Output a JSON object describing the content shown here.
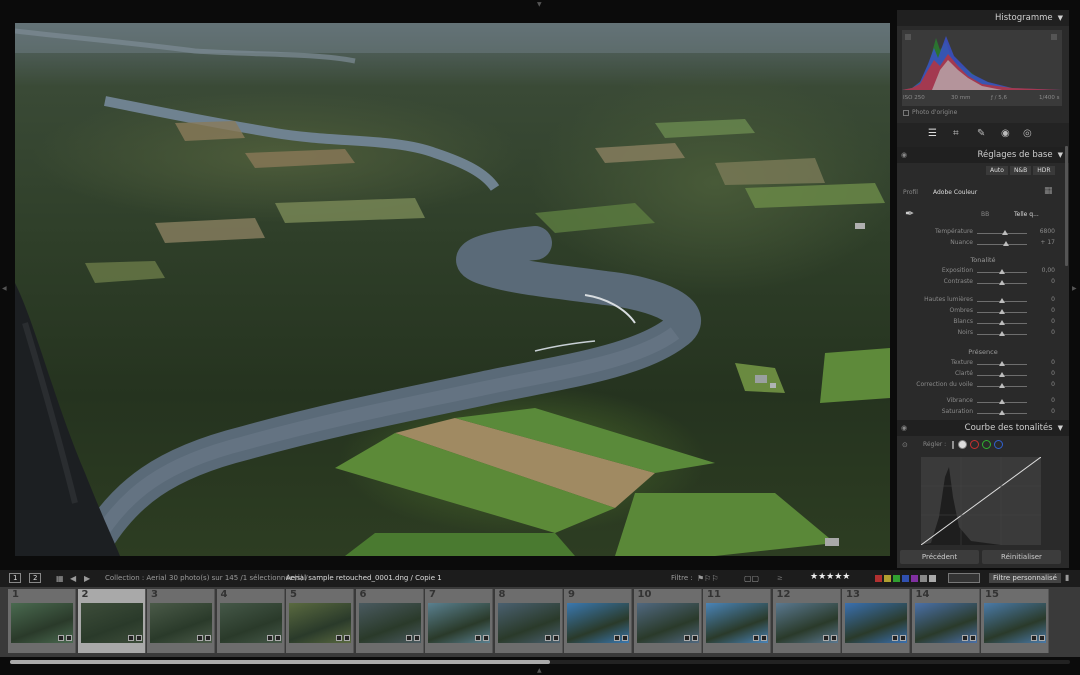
{
  "right_panel": {
    "histogram": {
      "title": "Histogramme",
      "iso": "ISO 250",
      "focal": "30 mm",
      "aperture": "ƒ / 5,6",
      "shutter": "1/400 s",
      "original_photo": "Photo d'origine"
    },
    "basic": {
      "title": "Réglages de base",
      "buttons": [
        "Auto",
        "N&B",
        "HDR"
      ],
      "profile_label": "Profil",
      "profile_value": "Adobe Couleur",
      "wb_label": "BB",
      "wb_value": "Telle q...",
      "sliders_wb": [
        {
          "label": "Température",
          "value": "6800",
          "pos": 0.55
        },
        {
          "label": "Nuance",
          "value": "+ 17",
          "pos": 0.58
        }
      ],
      "tone_title": "Tonalité",
      "sliders_tone": [
        {
          "label": "Exposition",
          "value": "0,00",
          "pos": 0.5
        },
        {
          "label": "Contraste",
          "value": "0",
          "pos": 0.5
        },
        {
          "label": "Hautes lumières",
          "value": "0",
          "pos": 0.5
        },
        {
          "label": "Ombres",
          "value": "0",
          "pos": 0.5
        },
        {
          "label": "Blancs",
          "value": "0",
          "pos": 0.5
        },
        {
          "label": "Noirs",
          "value": "0",
          "pos": 0.5
        }
      ],
      "presence_title": "Présence",
      "sliders_presence": [
        {
          "label": "Texture",
          "value": "0",
          "pos": 0.5
        },
        {
          "label": "Clarté",
          "value": "0",
          "pos": 0.5
        },
        {
          "label": "Correction du voile",
          "value": "0",
          "pos": 0.5
        },
        {
          "label": "Vibrance",
          "value": "0",
          "pos": 0.5
        },
        {
          "label": "Saturation",
          "value": "0",
          "pos": 0.5
        }
      ]
    },
    "curve": {
      "title": "Courbe des tonalités",
      "adjust_label": "Régler :"
    },
    "bottom": {
      "previous": "Précédent",
      "reset": "Réinitialiser"
    }
  },
  "toolbar": {
    "view1": "1",
    "view2": "2",
    "collection": "Collection : Aerial",
    "count": "30 photo(s) sur 145 /1 sélectionnée(s) /",
    "filename": "Aerial sample retouched_0001.dng / Copie 1",
    "filter_label": "Filtre :",
    "filter_value": "Filtre personnalisé",
    "rating_stars": "★★★★★"
  },
  "colors": {
    "panel_bg": "#2a2a2a",
    "header_bg": "#202020",
    "film_bg": "#3a3a3a",
    "selected_cell": "#a9a9a9",
    "label_red": "#b03030",
    "label_yellow": "#b0a030",
    "label_green": "#30a030",
    "label_blue": "#3050b0",
    "label_purple": "#8030a0"
  },
  "filmstrip": {
    "cells": [
      {
        "num": "1",
        "tint": "#4a6a50"
      },
      {
        "num": "2",
        "tint": "#3d4d3a"
      },
      {
        "num": "3",
        "tint": "#4a5a48"
      },
      {
        "num": "4",
        "tint": "#455848"
      },
      {
        "num": "5",
        "tint": "#5a6a40"
      },
      {
        "num": "6",
        "tint": "#4a5a60"
      },
      {
        "num": "7",
        "tint": "#5a8090"
      },
      {
        "num": "8",
        "tint": "#4a6070"
      },
      {
        "num": "9",
        "tint": "#3a78b0"
      },
      {
        "num": "10",
        "tint": "#506880"
      },
      {
        "num": "11",
        "tint": "#4a84b8"
      },
      {
        "num": "12",
        "tint": "#5a7890"
      },
      {
        "num": "13",
        "tint": "#3a70b0"
      },
      {
        "num": "14",
        "tint": "#4a70a8"
      },
      {
        "num": "15",
        "tint": "#4a7aa8"
      }
    ]
  }
}
